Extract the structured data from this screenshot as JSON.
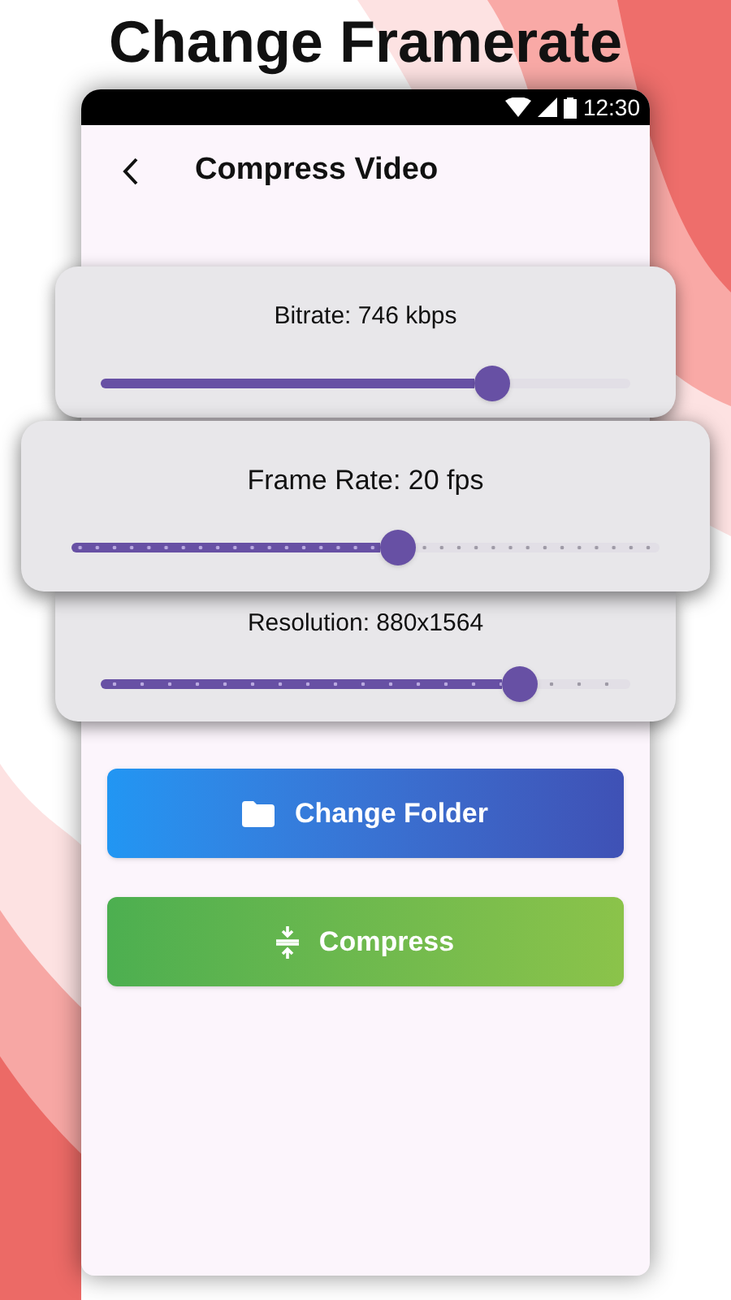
{
  "headline": "Change Framerate",
  "status_bar": {
    "time": "12:30"
  },
  "app_bar": {
    "title": "Compress Video"
  },
  "sliders": [
    {
      "label": "Bitrate: 746 kbps",
      "kind": "continuous",
      "level": 0.74
    },
    {
      "label": "Frame Rate: 20 fps",
      "kind": "fine-steps",
      "level": 0.555
    },
    {
      "label": "Resolution: 880x1564",
      "kind": "coarse-steps",
      "level": 0.79
    }
  ],
  "buttons": [
    {
      "label": "Change Folder",
      "kind": "folder"
    },
    {
      "label": "Compress",
      "kind": "compress"
    }
  ]
}
